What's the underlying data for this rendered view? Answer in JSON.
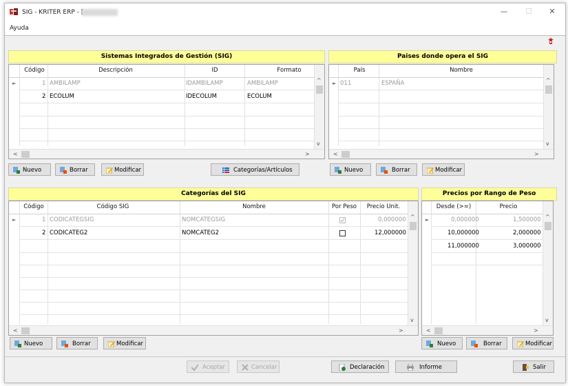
{
  "window": {
    "title": "SIG - KRITER ERP - [",
    "controls": [
      "—",
      "☐",
      "✕"
    ]
  },
  "menu": {
    "items": [
      "Ayuda"
    ]
  },
  "sig_panel": {
    "title": "Sistemas Integrados de Gestión (SIG)",
    "columns": [
      "Código",
      "Descripción",
      "ID",
      "Formato"
    ],
    "rows": [
      {
        "codigo": "1",
        "descripcion": "AMBILAMP",
        "id": "IDAMBILAMP",
        "formato": "AMBILAMP",
        "dim": true
      },
      {
        "codigo": "2",
        "descripcion": "ECOLUM",
        "id": "IDECOLUM",
        "formato": "ECOLUM",
        "dim": false
      }
    ],
    "buttons": {
      "nuevo": "Nuevo",
      "borrar": "Borrar",
      "modificar": "Modificar",
      "categorias": "Categorías/Artículos"
    }
  },
  "paises_panel": {
    "title": "Paises donde opera el SIG",
    "columns": [
      "País",
      "Nombre"
    ],
    "rows": [
      {
        "pais": "011",
        "nombre": "ESPAÑA",
        "dim": true
      }
    ],
    "buttons": {
      "nuevo": "Nuevo",
      "borrar": "Borrar",
      "modificar": "Modificar"
    }
  },
  "categorias_panel": {
    "title": "Categorías del SIG",
    "columns": [
      "Código",
      "Código SIG",
      "Nombre",
      "Por Peso",
      "Precio Unit."
    ],
    "rows": [
      {
        "codigo": "1",
        "codigo_sig": "CODICATEGSIG",
        "nombre": "NOMCATEGSIG",
        "por_peso": true,
        "precio": "0,000000",
        "dim": true
      },
      {
        "codigo": "2",
        "codigo_sig": "CODICATEG2",
        "nombre": "NOMCATEG2",
        "por_peso": false,
        "precio": "12,000000",
        "dim": false
      }
    ],
    "buttons": {
      "nuevo": "Nuevo",
      "borrar": "Borrar",
      "modificar": "Modificar"
    }
  },
  "precios_panel": {
    "title": "Precios por Rango de Peso",
    "columns": [
      "Desde (>=)",
      "Precio"
    ],
    "rows": [
      {
        "desde": "0,000000",
        "precio": "1,500000",
        "dim": true
      },
      {
        "desde": "10,000000",
        "precio": "2,000000",
        "dim": false
      },
      {
        "desde": "11,000000",
        "precio": "3,000000",
        "dim": false
      }
    ],
    "buttons": {
      "nuevo": "Nuevo",
      "borrar": "Borrar",
      "modificar": "Modificar"
    }
  },
  "footer": {
    "aceptar": "Aceptar",
    "cancelar": "Cancelar",
    "declaracion": "Declaración",
    "informe": "Informe",
    "salir": "Salir"
  },
  "colors": {
    "header_bg": "#ffff99",
    "grid_border": "#a0a0a0",
    "button_bg": "#e1e1e1"
  }
}
